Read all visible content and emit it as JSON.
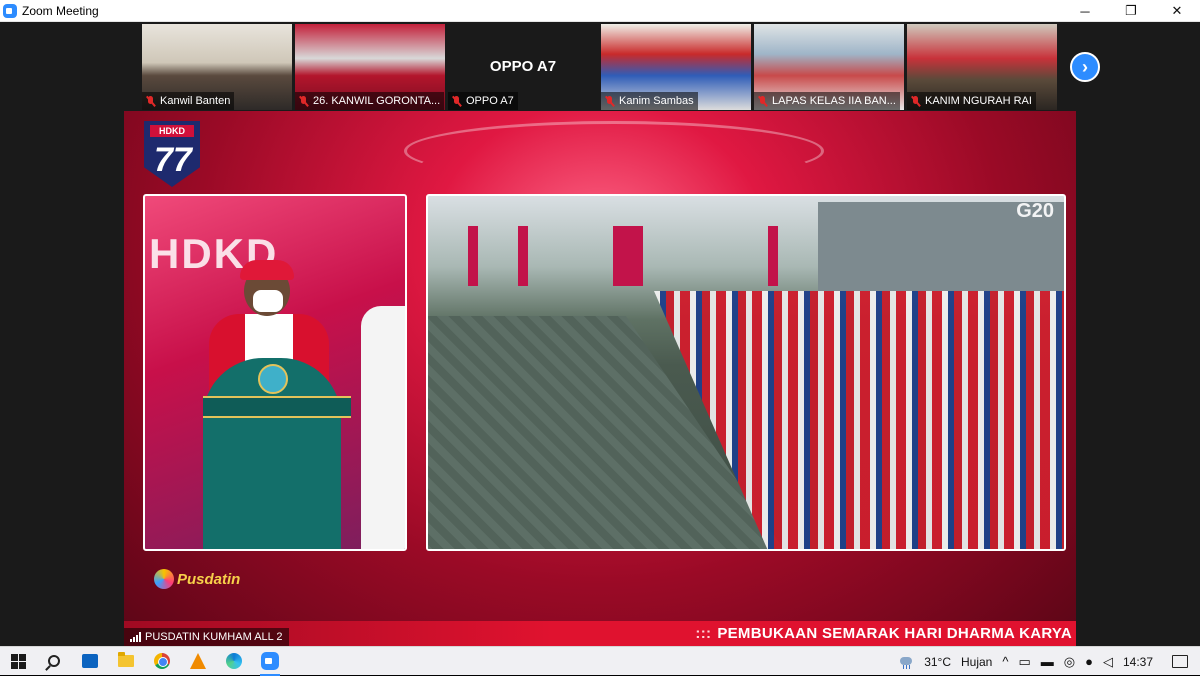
{
  "window": {
    "title": "Zoom Meeting",
    "controls": {
      "minimize": "─",
      "restore": "❐",
      "close": "✕"
    }
  },
  "participants": [
    {
      "name": "Kanwil Banten",
      "muted": true,
      "video": true
    },
    {
      "name": "26. KANWIL GORONTA...",
      "muted": true,
      "video": true
    },
    {
      "name": "OPPO A7",
      "muted": true,
      "video": false
    },
    {
      "name": "Kanim Sambas",
      "muted": true,
      "video": true
    },
    {
      "name": "LAPAS KELAS IIA BAN...",
      "muted": true,
      "video": true
    },
    {
      "name": "KANIM NGURAH RAI",
      "muted": true,
      "video": true
    }
  ],
  "strip_next": "›",
  "stage": {
    "logo_text": "HDKD",
    "logo_number": "77",
    "backdrop_text": "HDKD",
    "g20_text": "G20",
    "brand": "Pusdatin",
    "ticker_prefix": ":::",
    "ticker_text": "PEMBUKAAN SEMARAK HARI DHARMA KARYA"
  },
  "active_speaker": "PUSDATIN KUMHAM ALL 2",
  "taskbar": {
    "apps": [
      "windows-start",
      "search",
      "task-view",
      "file-explorer",
      "chrome",
      "vlc",
      "edge",
      "zoom"
    ],
    "weather_temp": "31°C",
    "weather_desc": "Hujan",
    "tray_chevron": "^",
    "time": "14:37"
  },
  "colors": {
    "zoom_blue": "#2d8cff",
    "stage_red": "#e0122f",
    "muted_red": "#e02828"
  }
}
